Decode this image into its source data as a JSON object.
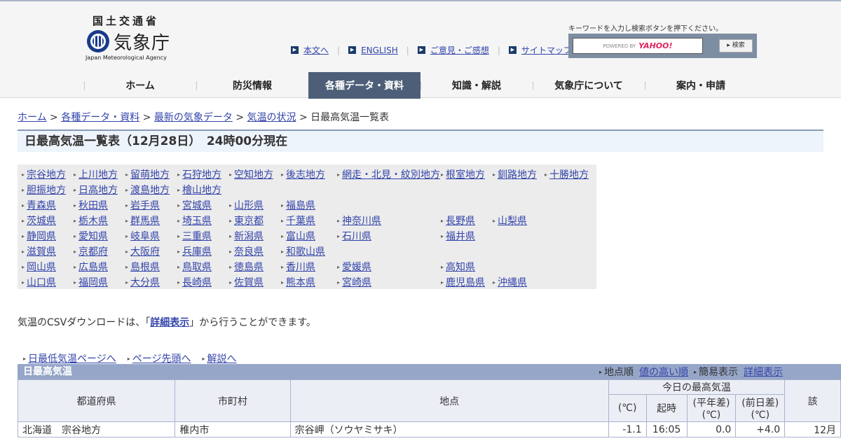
{
  "header": {
    "logo": {
      "top_kanji": "国土交通省",
      "main_kanji": "気象庁",
      "english": "Japan Meteorological Agency"
    },
    "util_links": [
      "本文へ",
      "ENGLISH",
      "ご意見・ご感想",
      "サイトマップ"
    ],
    "search": {
      "hint": "キーワードを入力し検索ボタンを押下ください。",
      "powered_by": "POWERED BY",
      "provider": "YAHOO!",
      "button": "検索"
    },
    "nav": [
      "ホーム",
      "防災情報",
      "各種データ・資料",
      "知識・解説",
      "気象庁について",
      "案内・申請"
    ],
    "active_nav": "各種データ・資料"
  },
  "breadcrumb": {
    "links": [
      "ホーム",
      "各種データ・資料",
      "最新の気象データ",
      "気温の状況"
    ],
    "separator": ">",
    "current": "日最高気温一覧表"
  },
  "title": "日最高気温一覧表（12月28日）　24時00分現在",
  "regions": {
    "rows": [
      [
        "宗谷地方",
        "上川地方",
        "留萌地方",
        "石狩地方",
        "空知地方",
        "後志地方",
        "網走・北見・紋別地方",
        "根室地方",
        "釧路地方",
        "十勝地方"
      ],
      [
        "胆振地方",
        "日高地方",
        "渡島地方",
        "檜山地方"
      ],
      [
        "青森県",
        "秋田県",
        "岩手県",
        "宮城県",
        "山形県",
        "福島県"
      ],
      [
        "茨城県",
        "栃木県",
        "群馬県",
        "埼玉県",
        "東京都",
        "千葉県",
        "神奈川県",
        "長野県",
        "山梨県"
      ],
      [
        "静岡県",
        "愛知県",
        "岐阜県",
        "三重県",
        "新潟県",
        "富山県",
        "石川県",
        "福井県"
      ],
      [
        "滋賀県",
        "京都府",
        "大阪府",
        "兵庫県",
        "奈良県",
        "和歌山県"
      ],
      [
        "岡山県",
        "広島県",
        "島根県",
        "鳥取県",
        "徳島県",
        "香川県",
        "愛媛県",
        "高知県"
      ],
      [
        "山口県",
        "福岡県",
        "大分県",
        "長崎県",
        "佐賀県",
        "熊本県",
        "宮崎県",
        "鹿児島県",
        "沖縄県"
      ]
    ]
  },
  "csv_note": {
    "before": "気温のCSVダウンロードは、「",
    "link": "詳細表示",
    "after": "」から行うことができます。"
  },
  "quick_links": [
    "日最低気温ページへ",
    "ページ先頭へ",
    "解説へ"
  ],
  "table": {
    "caption": "日最高気温",
    "options": {
      "order_label": "地点順",
      "order_link": "値の高い順",
      "view_label": "簡易表示",
      "view_link": "詳細表示"
    },
    "headers": {
      "pref": "都道府県",
      "city": "市町村",
      "point": "地点",
      "today_max": "今日の最高気温",
      "unit": "(℃)",
      "time": "起時",
      "normal_diff": "(平年差)",
      "normal_unit": "(℃)",
      "prev_diff": "(前日差)",
      "prev_unit": "(℃)",
      "last": "該"
    },
    "rows": [
      {
        "pref": "北海道　宗谷地方",
        "city": "稚内市",
        "point": "宗谷岬（ソウヤミサキ）",
        "temp": "-1.1",
        "time": "16:05",
        "normal": "0.0",
        "prev": "+4.0",
        "last": "12月"
      }
    ]
  }
}
